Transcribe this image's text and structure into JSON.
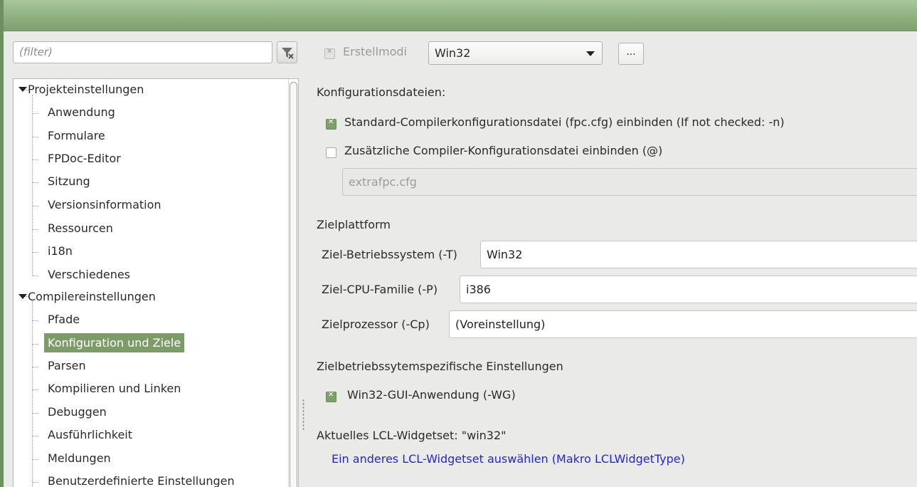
{
  "left_pane": {
    "filter_placeholder": "(filter)",
    "tree": [
      {
        "label": "Projekteinstellungen",
        "expanded": true,
        "children": [
          {
            "label": "Anwendung"
          },
          {
            "label": "Formulare"
          },
          {
            "label": "FPDoc-Editor"
          },
          {
            "label": "Sitzung"
          },
          {
            "label": "Versionsinformation"
          },
          {
            "label": "Ressourcen"
          },
          {
            "label": "i18n"
          },
          {
            "label": "Verschiedenes"
          }
        ]
      },
      {
        "label": "Compilereinstellungen",
        "expanded": true,
        "children": [
          {
            "label": "Pfade"
          },
          {
            "label": "Konfiguration und Ziele",
            "selected": true
          },
          {
            "label": "Parsen"
          },
          {
            "label": "Kompilieren und Linken"
          },
          {
            "label": "Debuggen"
          },
          {
            "label": "Ausführlichkeit"
          },
          {
            "label": "Meldungen"
          },
          {
            "label": "Benutzerdefinierte Einstellungen"
          }
        ]
      }
    ]
  },
  "build_modes": {
    "label": "Erstellmodi",
    "value": "Win32",
    "dots_label": "..."
  },
  "config_files": {
    "heading": "Konfigurationsdateien:",
    "standard_label": "Standard-Compilerkonfigurationsdatei (fpc.cfg) einbinden (If not checked: -n)",
    "standard_checked": true,
    "extra_label": "Zusätzliche Compiler-Konfigurationsdatei einbinden (@)",
    "extra_checked": false,
    "extra_value": "extrafpc.cfg"
  },
  "target_platform": {
    "heading": "Zielplattform",
    "os_label": "Ziel-Betriebssystem (-T)",
    "os_value": "Win32",
    "cpu_label": "Ziel-CPU-Familie (-P)",
    "cpu_value": "i386",
    "proc_label": "Zielprozessor (-Cp)",
    "proc_value": "(Voreinstellung)"
  },
  "os_specific": {
    "heading": "Zielbetriebssytemspezifische Einstellungen",
    "gui_label": "Win32-GUI-Anwendung (-WG)",
    "gui_checked": true
  },
  "lcl": {
    "current": "Aktuelles LCL-Widgetset: \"win32\"",
    "link": "Ein anderes LCL-Widgetset auswählen (Makro LCLWidgetType)"
  },
  "colors": {
    "accent": "#7d9b69",
    "titlebar": "#8fb07f",
    "link": "#2525d8"
  }
}
